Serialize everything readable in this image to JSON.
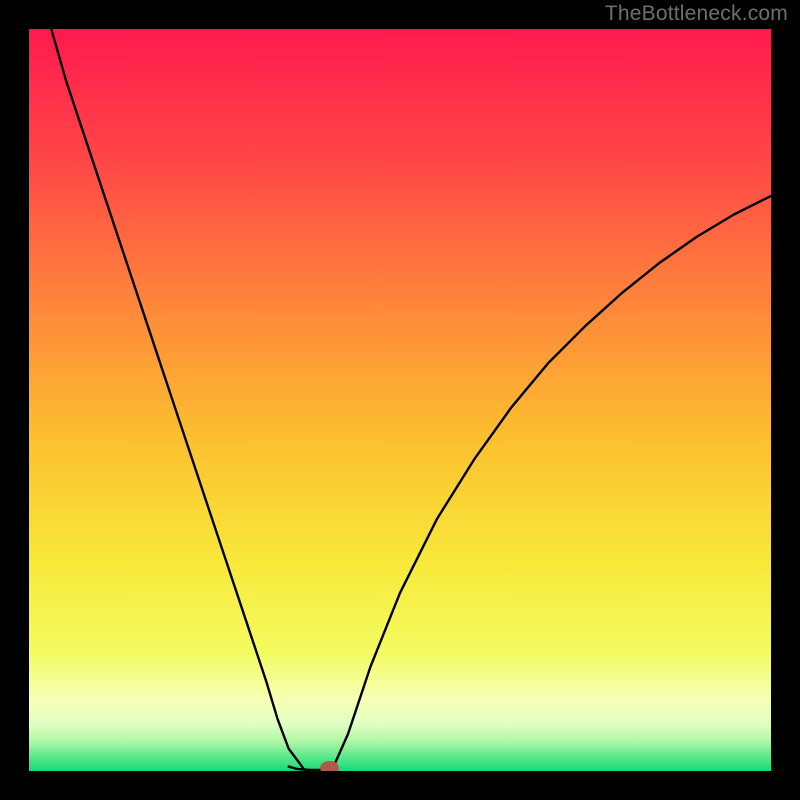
{
  "watermark": "TheBottleneck.com",
  "chart_data": {
    "type": "line",
    "title": "",
    "xlabel": "",
    "ylabel": "",
    "xlim": [
      0,
      100
    ],
    "ylim": [
      0,
      100
    ],
    "grid": false,
    "legend": false,
    "series": [
      {
        "name": "left-branch",
        "x": [
          3,
          5,
          8,
          11,
          14,
          17,
          20,
          23,
          26,
          29,
          32,
          33.5,
          35,
          36.5,
          37,
          37.5
        ],
        "y": [
          100,
          93,
          84,
          75,
          66,
          57,
          48,
          39,
          30,
          21,
          12,
          7,
          3,
          1,
          0.3,
          0
        ],
        "color": "#000000"
      },
      {
        "name": "valley-flat",
        "x": [
          35,
          36,
          37,
          38,
          39,
          40,
          41
        ],
        "y": [
          0.6,
          0.3,
          0.2,
          0.15,
          0.15,
          0.2,
          0.5
        ],
        "color": "#000000"
      },
      {
        "name": "right-branch",
        "x": [
          41,
          43,
          46,
          50,
          55,
          60,
          65,
          70,
          75,
          80,
          85,
          90,
          95,
          100
        ],
        "y": [
          0.5,
          5,
          14,
          24,
          34,
          42,
          49,
          55,
          60,
          64.5,
          68.5,
          72,
          75,
          77.5
        ],
        "color": "#000000"
      }
    ],
    "marker": {
      "x": 40.5,
      "y": 0,
      "rx": 1.2,
      "ry": 0.9,
      "color": "#b05a4a"
    },
    "background_gradient": {
      "stops": [
        {
          "offset": 0.0,
          "color": "#ff1a4d"
        },
        {
          "offset": 0.18,
          "color": "#ff4747"
        },
        {
          "offset": 0.38,
          "color": "#ff893a"
        },
        {
          "offset": 0.55,
          "color": "#fcbf2f"
        },
        {
          "offset": 0.72,
          "color": "#f8e93a"
        },
        {
          "offset": 0.84,
          "color": "#f3fb60"
        },
        {
          "offset": 0.905,
          "color": "#f6ffb7"
        },
        {
          "offset": 0.935,
          "color": "#e3ffc2"
        },
        {
          "offset": 0.96,
          "color": "#b0f7a6"
        },
        {
          "offset": 0.985,
          "color": "#49e686"
        },
        {
          "offset": 1.0,
          "color": "#17d977"
        }
      ]
    }
  }
}
